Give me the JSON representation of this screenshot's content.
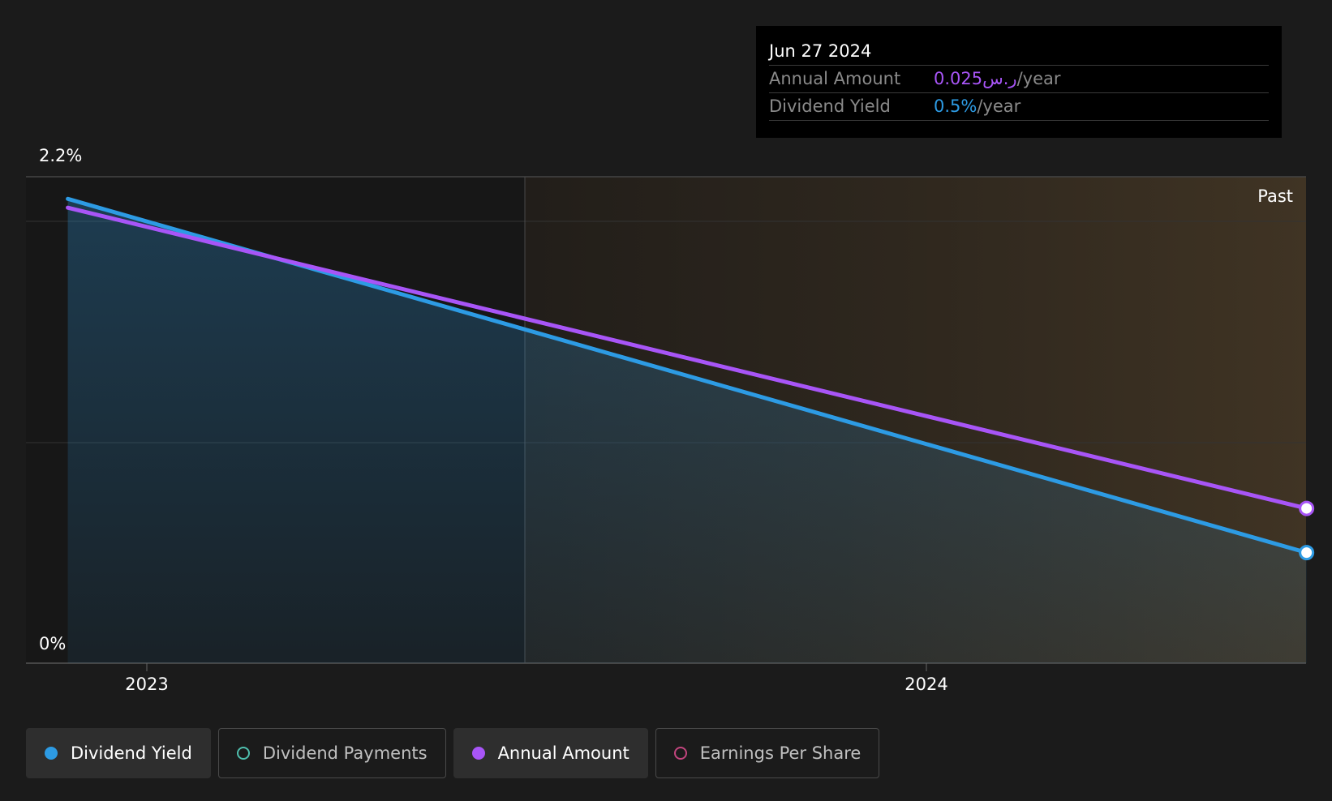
{
  "chart_data": {
    "type": "line",
    "x_ticks": [
      "2023",
      "2024"
    ],
    "y_ticks": [
      "2.2%",
      "0%"
    ],
    "ylim": [
      0,
      2.2
    ],
    "past_label": "Past",
    "series": [
      {
        "name": "Dividend Yield",
        "color": "#2d9be4",
        "points": [
          {
            "x": "2022-11-25",
            "y": 2.1
          },
          {
            "x": "2024-06-27",
            "y": 0.5
          }
        ]
      },
      {
        "name": "Annual Amount",
        "color": "#a855f7",
        "points": [
          {
            "x": "2022-11-25",
            "y": 2.06
          },
          {
            "x": "2024-06-27",
            "y": 0.7
          }
        ]
      }
    ]
  },
  "tooltip": {
    "date": "Jun 27 2024",
    "rows": [
      {
        "label": "Annual Amount",
        "value": "0.025ر.س",
        "unit": "/year",
        "color": "#a855f7"
      },
      {
        "label": "Dividend Yield",
        "value": "0.5%",
        "unit": "/year",
        "color": "#2d9be4"
      }
    ]
  },
  "legend": [
    {
      "label": "Dividend Yield",
      "color": "#2d9be4",
      "active": true
    },
    {
      "label": "Dividend Payments",
      "color": "#4fbfae",
      "active": false
    },
    {
      "label": "Annual Amount",
      "color": "#a855f7",
      "active": true
    },
    {
      "label": "Earnings Per Share",
      "color": "#c2457e",
      "active": false
    }
  ]
}
